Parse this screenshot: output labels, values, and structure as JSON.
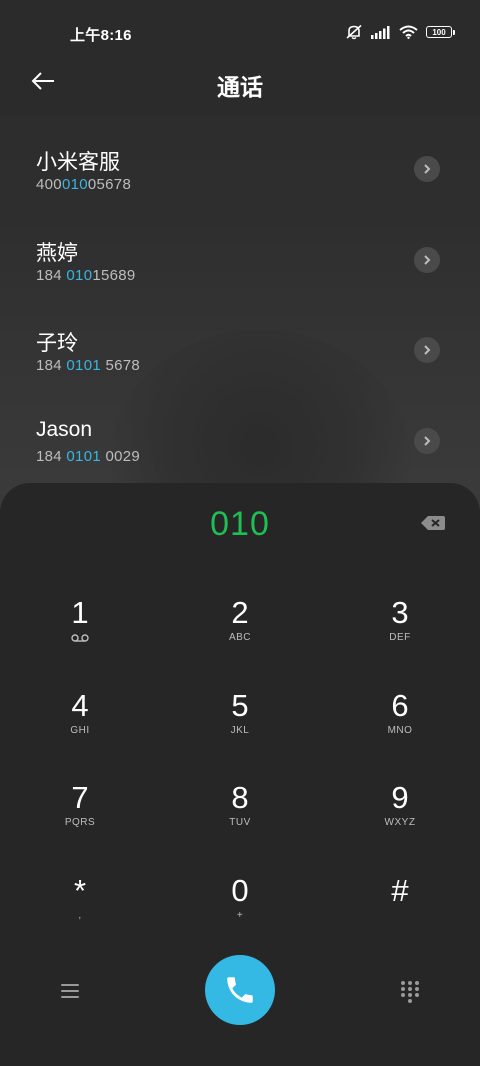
{
  "status_bar": {
    "time": "上午8:16",
    "battery": "100"
  },
  "header": {
    "title": "通话"
  },
  "contacts": [
    {
      "name": "小米客服",
      "number_pre": "400",
      "number_match": "010",
      "number_post": "05678"
    },
    {
      "name": "燕婷",
      "number_pre": "184 ",
      "number_match": "010",
      "number_post": "15689"
    },
    {
      "name": "子玲",
      "number_pre": "184 ",
      "number_match": "0101",
      "number_post": " 5678"
    },
    {
      "name": "Jason",
      "number_pre": "184 ",
      "number_match": "0101",
      "number_post": " 0029"
    }
  ],
  "dialpad": {
    "dialed": "010",
    "keys": [
      {
        "digit": "1",
        "letters": ""
      },
      {
        "digit": "2",
        "letters": "ABC"
      },
      {
        "digit": "3",
        "letters": "DEF"
      },
      {
        "digit": "4",
        "letters": "GHI"
      },
      {
        "digit": "5",
        "letters": "JKL"
      },
      {
        "digit": "6",
        "letters": "MNO"
      },
      {
        "digit": "7",
        "letters": "PQRS"
      },
      {
        "digit": "8",
        "letters": "TUV"
      },
      {
        "digit": "9",
        "letters": "WXYZ"
      },
      {
        "digit": "*",
        "letters": ","
      },
      {
        "digit": "0",
        "letters": "+"
      },
      {
        "digit": "#",
        "letters": ""
      }
    ]
  },
  "colors": {
    "accent_blue": "#33b9e3",
    "match_highlight": "#38b6e0",
    "dialed_green": "#1fbf55",
    "background": "#262626"
  },
  "icons": {
    "back": "arrow-left-icon",
    "detail": "chevron-right-icon",
    "backspace": "backspace-icon",
    "voicemail": "voicemail-icon",
    "menu": "menu-icon",
    "call": "phone-icon",
    "keypad": "dialpad-icon"
  }
}
